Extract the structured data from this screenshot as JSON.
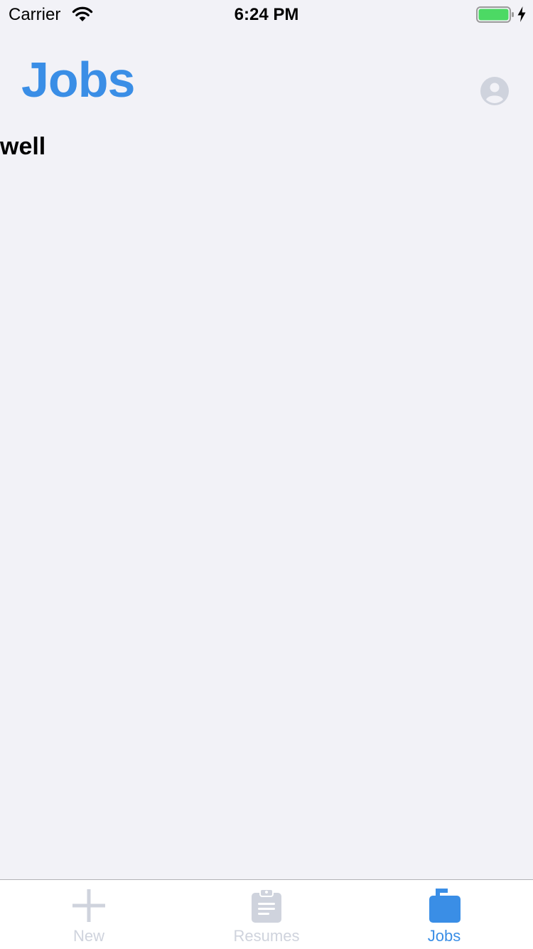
{
  "status_bar": {
    "carrier": "Carrier",
    "time": "6:24 PM",
    "wifi_icon": "wifi-icon",
    "battery_icon": "battery-charging-icon",
    "battery_color": "#4cd964"
  },
  "header": {
    "title": "Jobs",
    "title_color": "#3a8ee6",
    "profile_icon": "person-circle-icon"
  },
  "content": {
    "items": [
      {
        "text": "well"
      }
    ]
  },
  "tab_bar": {
    "active_color": "#3a8ee6",
    "inactive_color": "#cfd3dd",
    "tabs": [
      {
        "label": "New",
        "icon": "plus-icon",
        "active": false
      },
      {
        "label": "Resumes",
        "icon": "clipboard-icon",
        "active": false
      },
      {
        "label": "Jobs",
        "icon": "briefcase-icon",
        "active": true
      }
    ]
  }
}
